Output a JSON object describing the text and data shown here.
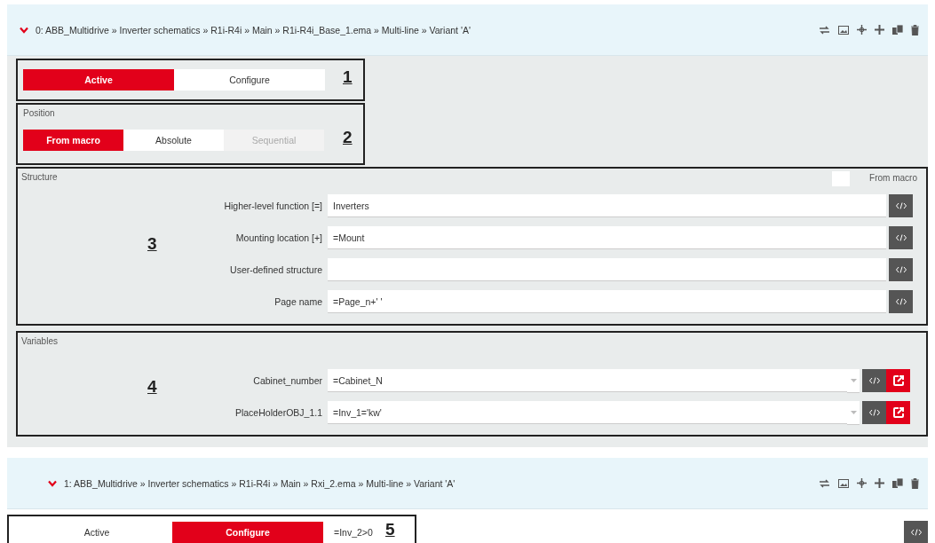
{
  "blocks": [
    {
      "header": {
        "title": "0: ABB_Multidrive » Inverter schematics » R1i-R4i » Main » R1i-R4i_Base_1.ema » Multi-line » Variant 'A'",
        "expanded": true
      },
      "mode": {
        "options": [
          {
            "label": "Active",
            "selected": true
          },
          {
            "label": "Configure",
            "selected": false
          }
        ],
        "marker": "1"
      },
      "position": {
        "title": "Position",
        "options": [
          {
            "label": "From macro",
            "selected": true,
            "disabled": false
          },
          {
            "label": "Absolute",
            "selected": false,
            "disabled": false
          },
          {
            "label": "Sequential",
            "selected": false,
            "disabled": true
          }
        ],
        "marker": "2"
      },
      "structure": {
        "title": "Structure",
        "from_macro": {
          "label": "From macro",
          "checked": false
        },
        "marker": "3",
        "rows": [
          {
            "label": "Higher-level function [=]",
            "value": "Inverters"
          },
          {
            "label": "Mounting location [+]",
            "value": "=Mount"
          },
          {
            "label": "User-defined structure"
          },
          {
            "label": "Page name",
            "value": "=Page_n+' '"
          }
        ]
      },
      "variables": {
        "title": "Variables",
        "marker": "4",
        "rows": [
          {
            "label": "Cabinet_number",
            "value": "=Cabinet_N"
          },
          {
            "label": "PlaceHolderOBJ_1.1",
            "value": "=Inv_1='kw'"
          }
        ]
      }
    },
    {
      "header": {
        "title": "1: ABB_Multidrive » Inverter schematics » R1i-R4i » Main » Rxi_2.ema » Multi-line » Variant 'A'",
        "expanded": true
      },
      "mode": {
        "options": [
          {
            "label": "Active",
            "selected": false
          },
          {
            "label": "Configure",
            "selected": true
          }
        ],
        "marker": "5",
        "condition": "=Inv_2>0"
      }
    }
  ]
}
